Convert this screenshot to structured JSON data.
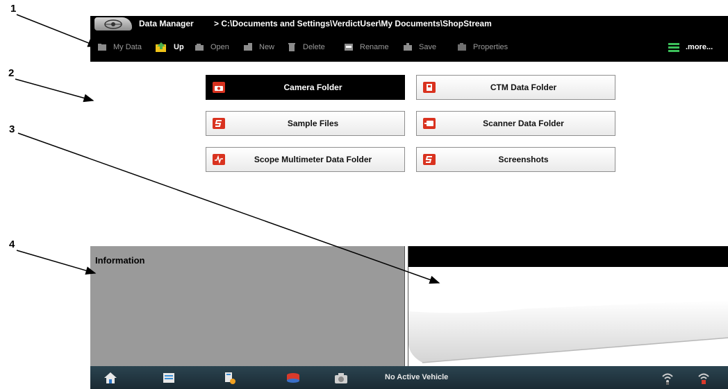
{
  "callouts": [
    "1",
    "2",
    "3",
    "4"
  ],
  "titlebar": {
    "app_title": "Data Manager",
    "path": "> C:\\Documents and Settings\\VerdictUser\\My Documents\\ShopStream"
  },
  "toolbar": {
    "my_data": "My Data",
    "up": "Up",
    "open": "Open",
    "new": "New",
    "delete": "Delete",
    "rename": "Rename",
    "save": "Save",
    "properties": "Properties",
    "more": ".more..."
  },
  "folders": [
    {
      "label": "Camera Folder",
      "icon": "camera-icon",
      "selected": true
    },
    {
      "label": "CTM Data Folder",
      "icon": "ctm-icon",
      "selected": false
    },
    {
      "label": "Sample Files",
      "icon": "snapon-logo-icon",
      "selected": false
    },
    {
      "label": "Scanner Data Folder",
      "icon": "scanner-icon",
      "selected": false
    },
    {
      "label": "Scope Multimeter Data Folder",
      "icon": "scope-icon",
      "selected": false
    },
    {
      "label": "Screenshots",
      "icon": "snapon-logo-icon",
      "selected": false
    }
  ],
  "info_panel": {
    "heading": "Information"
  },
  "status_bar": {
    "vehicle": "No Active Vehicle"
  },
  "colors": {
    "toolbar_bg": "#000000",
    "info_panel_bg": "#9a9a9a",
    "folder_icon": "#d9321f",
    "bottom_bar": "#22363f"
  }
}
